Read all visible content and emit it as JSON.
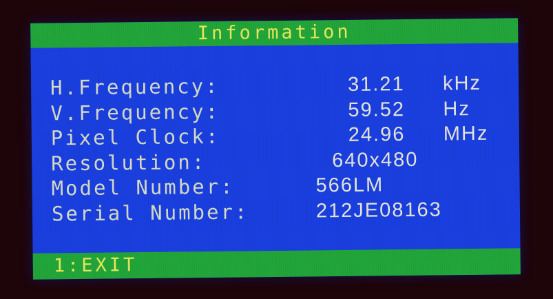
{
  "osd": {
    "title": "Information",
    "colors": {
      "panel": "#1a3fe0",
      "bars": "#22a63a",
      "title_text": "#e8e85a",
      "body_text": "#d6dcc8"
    },
    "rows": [
      {
        "label": "H.Frequency:",
        "value": "31.21",
        "unit": "kHz"
      },
      {
        "label": "V.Frequency:",
        "value": "59.52",
        "unit": "Hz"
      },
      {
        "label": "Pixel Clock:",
        "value": "24.96",
        "unit": "MHz"
      },
      {
        "label": "Resolution:",
        "value": "640x480",
        "unit": ""
      },
      {
        "label": "Model Number:",
        "value": "566LM",
        "unit": ""
      },
      {
        "label": "Serial Number:",
        "value": "212JE08163",
        "unit": ""
      }
    ],
    "exit_label": "1:EXIT"
  }
}
